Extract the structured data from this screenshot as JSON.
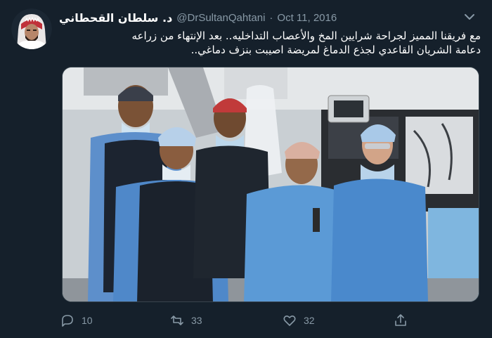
{
  "tweet": {
    "display_name": "د. سلطان القحطاني",
    "handle": "@DrSultanQahtani",
    "separator": "·",
    "date": "Oct 11, 2016",
    "text": "مع فريقنا المميز لجراحة شرايين المخ والأعصاب التداخليه.. بعد الإنتهاء من زراعه\nدعامة الشريان القاعدي لجذع الدماغ لمريضة اصيبت بنزف دماغي..",
    "image_alt": "team photo"
  },
  "actions": {
    "reply": {
      "icon": "reply-icon",
      "count": "10"
    },
    "retweet": {
      "icon": "retweet-icon",
      "count": "33"
    },
    "like": {
      "icon": "heart-icon",
      "count": "32"
    },
    "share": {
      "icon": "share-icon"
    }
  },
  "colors": {
    "background": "#15202b",
    "secondary_text": "#8899a6",
    "border": "#38444d"
  }
}
